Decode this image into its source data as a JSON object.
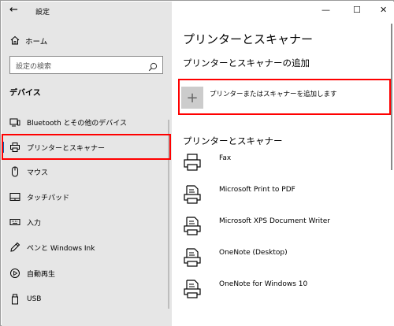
{
  "window": {
    "title": "設定",
    "back_icon": "back-arrow-icon",
    "minimize": "—",
    "maximize": "☐",
    "close": "✕"
  },
  "sidebar": {
    "home_label": "ホーム",
    "search_placeholder": "設定の検索",
    "section_title": "デバイス",
    "items": [
      {
        "label": "Bluetooth とその他のデバイス",
        "icon": "bluetooth-devices-icon"
      },
      {
        "label": "プリンターとスキャナー",
        "icon": "printer-icon",
        "selected": true
      },
      {
        "label": "マウス",
        "icon": "mouse-icon"
      },
      {
        "label": "タッチパッド",
        "icon": "touchpad-icon"
      },
      {
        "label": "入力",
        "icon": "keyboard-icon"
      },
      {
        "label": "ペンと Windows Ink",
        "icon": "pen-icon"
      },
      {
        "label": "自動再生",
        "icon": "autoplay-icon"
      },
      {
        "label": "USB",
        "icon": "usb-icon"
      }
    ]
  },
  "main": {
    "title": "プリンターとスキャナー",
    "add_section_title": "プリンターとスキャナーの追加",
    "add_button_label": "プリンターまたはスキャナーを追加します",
    "list_section_title": "プリンターとスキャナー",
    "printers": [
      {
        "name": "Fax",
        "icon": "fax-printer-icon"
      },
      {
        "name": "Microsoft Print to PDF",
        "icon": "printer-document-icon"
      },
      {
        "name": "Microsoft XPS Document Writer",
        "icon": "printer-document-icon"
      },
      {
        "name": "OneNote (Desktop)",
        "icon": "printer-document-icon"
      },
      {
        "name": "OneNote for Windows 10",
        "icon": "printer-document-icon"
      }
    ]
  },
  "colors": {
    "accent": "#0063b1",
    "highlight": "#ff0000",
    "sidebar_bg": "#e6e6e6"
  }
}
